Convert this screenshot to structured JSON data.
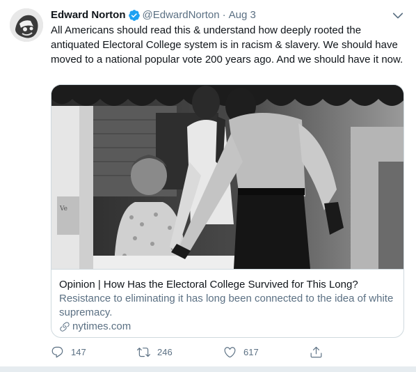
{
  "tweet": {
    "author_name": "Edward Norton",
    "handle": "@EdwardNorton",
    "separator": "·",
    "date": "Aug 3",
    "text": "All Americans should read this & understand how deeply rooted the antiquated Electoral College system  is in racism & slavery.  We should have moved to a national popular vote 200 years ago.  And we should have it now.",
    "verified": true
  },
  "card": {
    "title": "Opinion | How Has the Electoral College Survived for This Long?",
    "description": "Resistance to eliminating it has long been connected to the idea of white supremacy.",
    "domain": "nytimes.com"
  },
  "actions": {
    "reply_count": "147",
    "retweet_count": "246",
    "like_count": "617"
  },
  "icons": {
    "verified": "verified-badge-icon",
    "caret": "chevron-down-icon",
    "link": "link-icon",
    "reply": "reply-icon",
    "retweet": "retweet-icon",
    "like": "heart-icon",
    "share": "share-icon"
  },
  "colors": {
    "accent": "#1da1f2",
    "secondary_text": "#5b7083",
    "border": "#cfd9de"
  }
}
